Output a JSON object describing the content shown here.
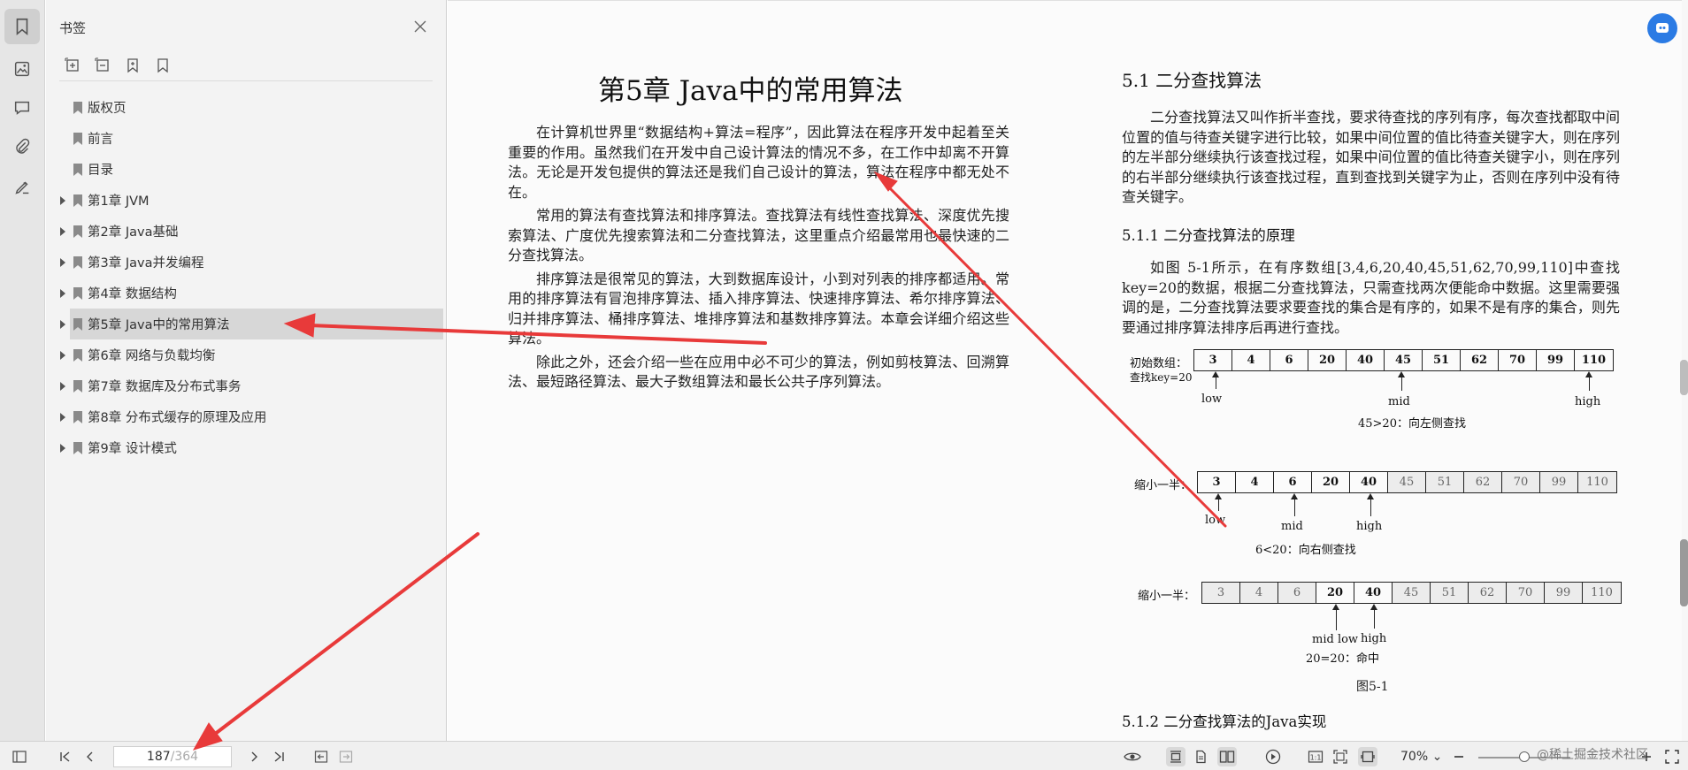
{
  "sidebar": {
    "title": "书签",
    "bookmarks": [
      {
        "label": "版权页",
        "expandable": false
      },
      {
        "label": "前言",
        "expandable": false
      },
      {
        "label": "目录",
        "expandable": false
      },
      {
        "label": "第1章 JVM",
        "expandable": true
      },
      {
        "label": "第2章 Java基础",
        "expandable": true
      },
      {
        "label": "第3章 Java并发编程",
        "expandable": true
      },
      {
        "label": "第4章 数据结构",
        "expandable": true
      },
      {
        "label": "第5章 Java中的常用算法",
        "expandable": true,
        "selected": true
      },
      {
        "label": "第6章 网络与负载均衡",
        "expandable": true
      },
      {
        "label": "第7章 数据库及分布式事务",
        "expandable": true
      },
      {
        "label": "第8章 分布式缓存的原理及应用",
        "expandable": true
      },
      {
        "label": "第9章 设计模式",
        "expandable": true
      }
    ]
  },
  "page_left": {
    "chapter_title": "第5章 Java中的常用算法",
    "paragraphs": [
      "在计算机世界里“数据结构+算法=程序”，因此算法在程序开发中起着至关重要的作用。虽然我们在开发中自己设计算法的情况不多，在工作中却离不开算法。无论是开发包提供的算法还是我们自己设计的算法，算法在程序中都无处不在。",
      "常用的算法有查找算法和排序算法。查找算法有线性查找算法、深度优先搜索算法、广度优先搜索算法和二分查找算法，这里重点介绍最常用也最快速的二分查找算法。",
      "排序算法是很常见的算法，大到数据库设计，小到对列表的排序都适用。常用的排序算法有冒泡排序算法、插入排序算法、快速排序算法、希尔排序算法、归并排序算法、桶排序算法、堆排序算法和基数排序算法。本章会详细介绍这些算法。",
      "除此之外，还会介绍一些在应用中必不可少的算法，例如剪枝算法、回溯算法、最短路径算法、最大子数组算法和最长公共子序列算法。"
    ]
  },
  "page_right": {
    "section_title": "5.1 二分查找算法",
    "section_paragraph": "二分查找算法又叫作折半查找，要求待查找的序列有序，每次查找都取中间位置的值与待查关键字进行比较，如果中间位置的值比待查关键字大，则在序列的左半部分继续执行该查找过程，如果中间位置的值比待查关键字小，则在序列的右半部分继续执行该查找过程，直到查找到关键字为止，否则在序列中没有待查关键字。",
    "subsection1_title": "5.1.1 二分查找算法的原理",
    "subsection1_paragraph": "如图 5-1所示，在有序数组[3,4,6,20,40,45,51,62,70,99,110]中查找key=20的数据，根据二分查找算法，只需查找两次便能命中数据。这里需要强调的是，二分查找算法要求要查找的集合是有序的，如果不是有序的集合，则先要通过排序算法排序后再进行查找。",
    "subsection2_title": "5.1.2 二分查找算法的Java实现",
    "figure": {
      "caption": "图5-1",
      "values": [
        "3",
        "4",
        "6",
        "20",
        "40",
        "45",
        "51",
        "62",
        "70",
        "99",
        "110"
      ],
      "row1": {
        "label": "初始数组：",
        "label2": "查找key=20",
        "low": "low",
        "mid": "mid",
        "high": "high",
        "note": "45>20：向左侧查找"
      },
      "row2": {
        "label": "缩小一半：",
        "low": "low",
        "mid": "mid",
        "high": "high",
        "note": "6<20：向右侧查找"
      },
      "row3": {
        "label": "缩小一半：",
        "midlow": "mid low",
        "high": "high",
        "note": "20=20：命中"
      }
    }
  },
  "bottombar": {
    "current_page": "187",
    "total_pages": "/364",
    "zoom": "70%",
    "zoom_level": 0.5
  },
  "watermark": "@稀土掘金技术社区",
  "colors": {
    "accent": "#2b7be4",
    "annotation": "#e83a3a",
    "selected_bg": "#d7d7d7"
  }
}
